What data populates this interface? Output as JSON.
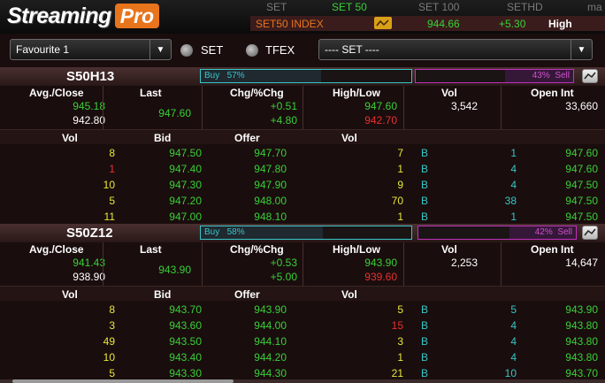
{
  "header": {
    "logo_a": "Streaming",
    "logo_b": "Pro",
    "tabs": [
      "SET",
      "SET 50",
      "SET 100",
      "SETHD",
      "ma"
    ],
    "index_name": "SET50 INDEX",
    "index_value": "944.66",
    "index_change": "+5.30",
    "index_status": "High"
  },
  "selection": {
    "favourite": "Favourite 1",
    "radio_set": "SET",
    "radio_tfex": "TFEX",
    "market": "---- SET ----"
  },
  "columns": {
    "avg_close": "Avg./Close",
    "last": "Last",
    "chg": "Chg/%Chg",
    "hilo": "High/Low",
    "vol": "Vol",
    "open_int": "Open Int",
    "bk_vol": "Vol",
    "bk_bid": "Bid",
    "bk_offer": "Offer",
    "bk_vol2": "Vol"
  },
  "panels": [
    {
      "symbol": "S50H13",
      "buy_label": "Buy",
      "buy_pct": "57%",
      "buy_fraction": 0.57,
      "sell_label": "Sell",
      "sell_pct": "43%",
      "sell_fraction": 0.43,
      "avg": "945.18",
      "close": "942.80",
      "last": "947.60",
      "chg": "+0.51",
      "pchg": "+4.80",
      "high": "947.60",
      "low": "942.70",
      "vol": "3,542",
      "open_int": "33,660",
      "book": [
        {
          "bid_vol": "8",
          "bid": "947.50",
          "offer": "947.70",
          "off_vol": "7",
          "side": "B",
          "cnt": "1",
          "px": "947.60"
        },
        {
          "bid_vol": "1",
          "bid": "947.40",
          "offer": "947.80",
          "off_vol": "1",
          "side": "B",
          "cnt": "4",
          "px": "947.60"
        },
        {
          "bid_vol": "10",
          "bid": "947.30",
          "offer": "947.90",
          "off_vol": "9",
          "side": "B",
          "cnt": "4",
          "px": "947.50"
        },
        {
          "bid_vol": "5",
          "bid": "947.20",
          "offer": "948.00",
          "off_vol": "70",
          "side": "B",
          "cnt": "38",
          "px": "947.50"
        },
        {
          "bid_vol": "11",
          "bid": "947.00",
          "offer": "948.10",
          "off_vol": "1",
          "side": "B",
          "cnt": "1",
          "px": "947.50"
        }
      ]
    },
    {
      "symbol": "S50Z12",
      "buy_label": "Buy",
      "buy_pct": "58%",
      "buy_fraction": 0.58,
      "sell_label": "Sell",
      "sell_pct": "42%",
      "sell_fraction": 0.42,
      "avg": "941.43",
      "close": "938.90",
      "last": "943.90",
      "chg": "+0.53",
      "pchg": "+5.00",
      "high": "943.90",
      "low": "939.60",
      "vol": "2,253",
      "open_int": "14,647",
      "book": [
        {
          "bid_vol": "8",
          "bid": "943.70",
          "offer": "943.90",
          "off_vol": "5",
          "side": "B",
          "cnt": "5",
          "px": "943.90"
        },
        {
          "bid_vol": "3",
          "bid": "943.60",
          "offer": "944.00",
          "off_vol": "15",
          "side": "B",
          "cnt": "4",
          "px": "943.80"
        },
        {
          "bid_vol": "49",
          "bid": "943.50",
          "offer": "944.10",
          "off_vol": "3",
          "side": "B",
          "cnt": "4",
          "px": "943.80"
        },
        {
          "bid_vol": "10",
          "bid": "943.40",
          "offer": "944.20",
          "off_vol": "1",
          "side": "B",
          "cnt": "4",
          "px": "943.80"
        },
        {
          "bid_vol": "5",
          "bid": "943.30",
          "offer": "944.30",
          "off_vol": "21",
          "side": "B",
          "cnt": "10",
          "px": "943.70"
        }
      ]
    }
  ],
  "colors": {
    "bg": "#1a0d0d",
    "green": "#38d038",
    "red": "#e83030",
    "yellow": "#e8e838",
    "cyan": "#35c7c7",
    "orange": "#e8741c",
    "magenta": "#c030c0"
  }
}
